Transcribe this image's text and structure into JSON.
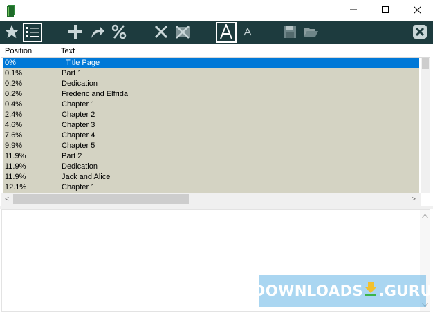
{
  "colors": {
    "toolbar_bg": "#1d3b3e",
    "list_bg": "#d4d3c3",
    "selection": "#0078d7",
    "watermark_bg": "#64b4e6"
  },
  "window": {
    "app_icon": "book-icon",
    "controls": [
      "minimize-icon",
      "maximize-icon",
      "close-icon"
    ]
  },
  "toolbar": {
    "buttons": [
      {
        "icon": "star-icon"
      },
      {
        "icon": "list-icon",
        "active": true
      },
      {
        "icon": "plus-icon"
      },
      {
        "icon": "redo-arrow-icon"
      },
      {
        "icon": "percent-icon"
      },
      {
        "icon": "delete-x-icon"
      },
      {
        "icon": "delete-all-icon"
      },
      {
        "icon": "font-large-icon",
        "label": "A",
        "active": true
      },
      {
        "icon": "font-small-icon",
        "label": "A"
      },
      {
        "icon": "save-icon"
      },
      {
        "icon": "open-folder-icon"
      },
      {
        "icon": "close-panel-icon"
      }
    ]
  },
  "list": {
    "columns": {
      "position": "Position",
      "text": "Text"
    },
    "rows": [
      {
        "position": "0%",
        "text": "Title Page",
        "selected": true
      },
      {
        "position": "0.1%",
        "text": "Part 1"
      },
      {
        "position": "0.2%",
        "text": "Dedication"
      },
      {
        "position": "0.2%",
        "text": "Frederic and Elfrida"
      },
      {
        "position": "0.4%",
        "text": "Chapter 1"
      },
      {
        "position": "2.4%",
        "text": "Chapter 2"
      },
      {
        "position": "4.6%",
        "text": "Chapter 3"
      },
      {
        "position": "7.6%",
        "text": "Chapter 4"
      },
      {
        "position": "9.9%",
        "text": "Chapter 5"
      },
      {
        "position": "11.9%",
        "text": "Part 2"
      },
      {
        "position": "11.9%",
        "text": "Dedication"
      },
      {
        "position": "11.9%",
        "text": "Jack and Alice"
      },
      {
        "position": "12.1%",
        "text": "Chapter 1"
      }
    ],
    "scroll_left": "<",
    "scroll_right": ">"
  },
  "watermark": {
    "prefix": "DOWNLOADS",
    "suffix": ".GURU"
  }
}
